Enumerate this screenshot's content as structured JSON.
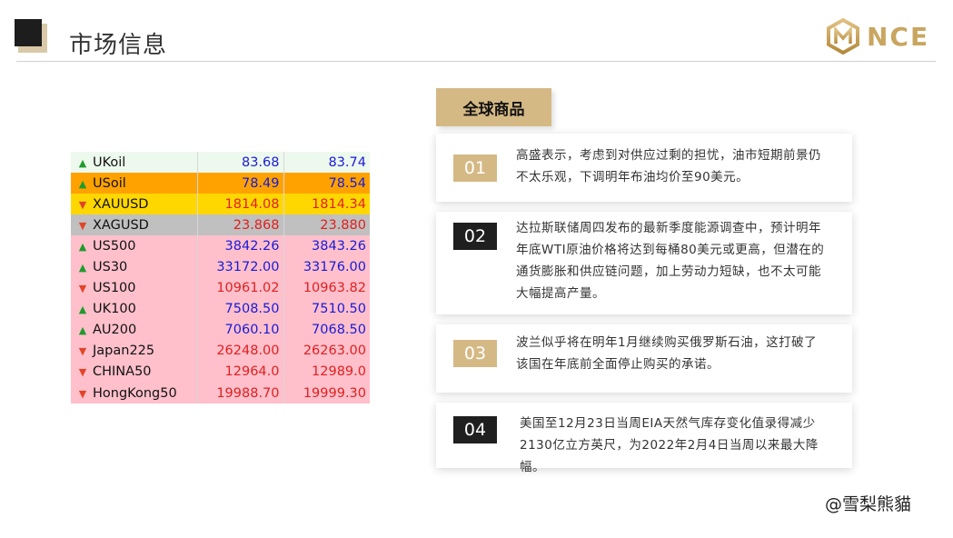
{
  "header": {
    "title": "市场信息",
    "logo_text": "NCE"
  },
  "quotes": [
    {
      "symbol": "UKoil",
      "dir": "up",
      "bid": "83.68",
      "ask": "83.74",
      "bg": "#edf9ed",
      "color": "#1a1ad8"
    },
    {
      "symbol": "USoil",
      "dir": "up",
      "bid": "78.49",
      "ask": "78.54",
      "bg": "#ffa200",
      "color": "#1a1ad8"
    },
    {
      "symbol": "XAUUSD",
      "dir": "down",
      "bid": "1814.08",
      "ask": "1814.34",
      "bg": "#ffd700",
      "color": "#e02020"
    },
    {
      "symbol": "XAGUSD",
      "dir": "down",
      "bid": "23.868",
      "ask": "23.880",
      "bg": "#c0c0c0",
      "color": "#e02020"
    },
    {
      "symbol": "US500",
      "dir": "up",
      "bid": "3842.26",
      "ask": "3843.26",
      "bg": "#ffc0cb",
      "color": "#1a1ad8"
    },
    {
      "symbol": "US30",
      "dir": "up",
      "bid": "33172.00",
      "ask": "33176.00",
      "bg": "#ffc0cb",
      "color": "#1a1ad8"
    },
    {
      "symbol": "US100",
      "dir": "down",
      "bid": "10961.02",
      "ask": "10963.82",
      "bg": "#ffc0cb",
      "color": "#e02020"
    },
    {
      "symbol": "UK100",
      "dir": "up",
      "bid": "7508.50",
      "ask": "7510.50",
      "bg": "#ffc0cb",
      "color": "#1a1ad8"
    },
    {
      "symbol": "AU200",
      "dir": "up",
      "bid": "7060.10",
      "ask": "7068.50",
      "bg": "#ffc0cb",
      "color": "#1a1ad8"
    },
    {
      "symbol": "Japan225",
      "dir": "down",
      "bid": "26248.00",
      "ask": "26263.00",
      "bg": "#ffc0cb",
      "color": "#e02020"
    },
    {
      "symbol": "CHINA50",
      "dir": "down",
      "bid": "12964.0",
      "ask": "12989.0",
      "bg": "#ffc0cb",
      "color": "#e02020"
    },
    {
      "symbol": "HongKong50",
      "dir": "down",
      "bid": "19988.70",
      "ask": "19999.30",
      "bg": "#ffc0cb",
      "color": "#e02020"
    }
  ],
  "section": {
    "label": "全球商品"
  },
  "news": [
    {
      "num": "01",
      "style": "gold",
      "lines": [
        "高盛表示，考虑到对供应过剩的担忧，油市短期前景仍",
        "不太乐观，下调明年布油均价至90美元。"
      ]
    },
    {
      "num": "02",
      "style": "dark",
      "lines": [
        "达拉斯联储周四发布的最新季度能源调查中，预计明年",
        "年底WTI原油价格将达到每桶80美元或更高，但潜在的",
        "通货膨胀和供应链问题，加上劳动力短缺，也不太可能",
        "大幅提高产量。"
      ]
    },
    {
      "num": "03",
      "style": "gold",
      "lines": [
        "波兰似乎将在明年1月继续购买俄罗斯石油，这打破了",
        "该国在年底前全面停止购买的承诺。"
      ]
    },
    {
      "num": "04",
      "style": "dark",
      "lines": [
        "美国至12月23日当周EIA天然气库存变化值录得减少",
        "2130亿立方英尺，为2022年2月4日当周以来最大降幅。"
      ]
    }
  ],
  "watermark": "@雪梨熊貓"
}
